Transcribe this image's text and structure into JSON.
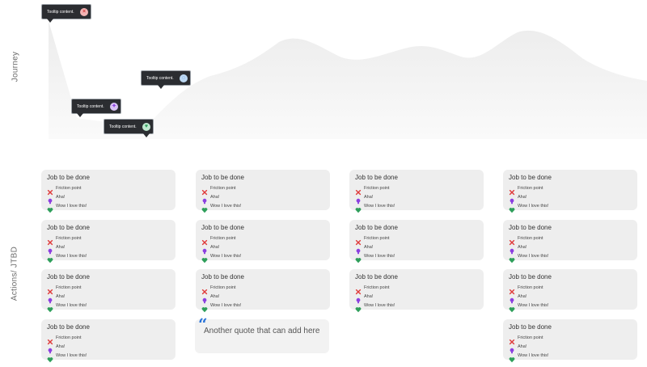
{
  "labels": {
    "journey": "Journey",
    "actions": "Actions/ JTBD"
  },
  "tooltips": [
    {
      "text": "Tooltip content.",
      "badge": "×",
      "badge_color": "#f3b3b3",
      "badge_fg": "#d23b3b"
    },
    {
      "text": "Tooltip content.",
      "badge": "◌",
      "badge_color": "#bcd8f3",
      "badge_fg": "#2a74d9"
    },
    {
      "text": "Tooltip content.",
      "badge": "✦",
      "badge_color": "#d9c2f5",
      "badge_fg": "#8b3fe0"
    },
    {
      "text": "Tooltip content.",
      "badge": "♥",
      "badge_color": "#bfe8cf",
      "badge_fg": "#2e9e5a"
    }
  ],
  "card": {
    "title": "Job to be done",
    "friction": "Friction point",
    "aha": "Aha!",
    "love": "Wow I love this!"
  },
  "quote": {
    "mark": "“",
    "text": "Another quote that can add here"
  },
  "colors": {
    "friction": "#e03b3b",
    "aha": "#8b3fe0",
    "love": "#2e9e5a"
  }
}
